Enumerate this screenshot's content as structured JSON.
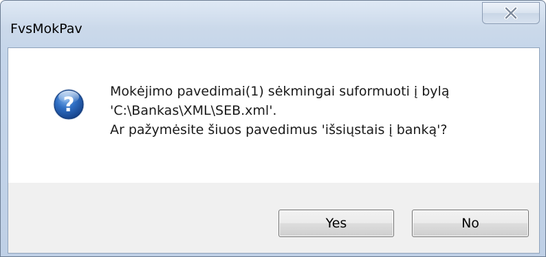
{
  "window": {
    "title": "FvsMokPav",
    "close_icon": "close-x"
  },
  "message": {
    "icon": "question-icon",
    "line1": "Mokėjimo pavedimai(1) sėkmingai suformuoti į bylą",
    "line2": "'C:\\Bankas\\XML\\SEB.xml'.",
    "line3": "Ar pažymėsite šiuos pavedimus 'išsiųstais į banką'?"
  },
  "buttons": {
    "yes_label": "Yes",
    "no_label": "No"
  },
  "colors": {
    "icon_blue": "#2a63b5",
    "title_bar": "#cbd9ea"
  }
}
